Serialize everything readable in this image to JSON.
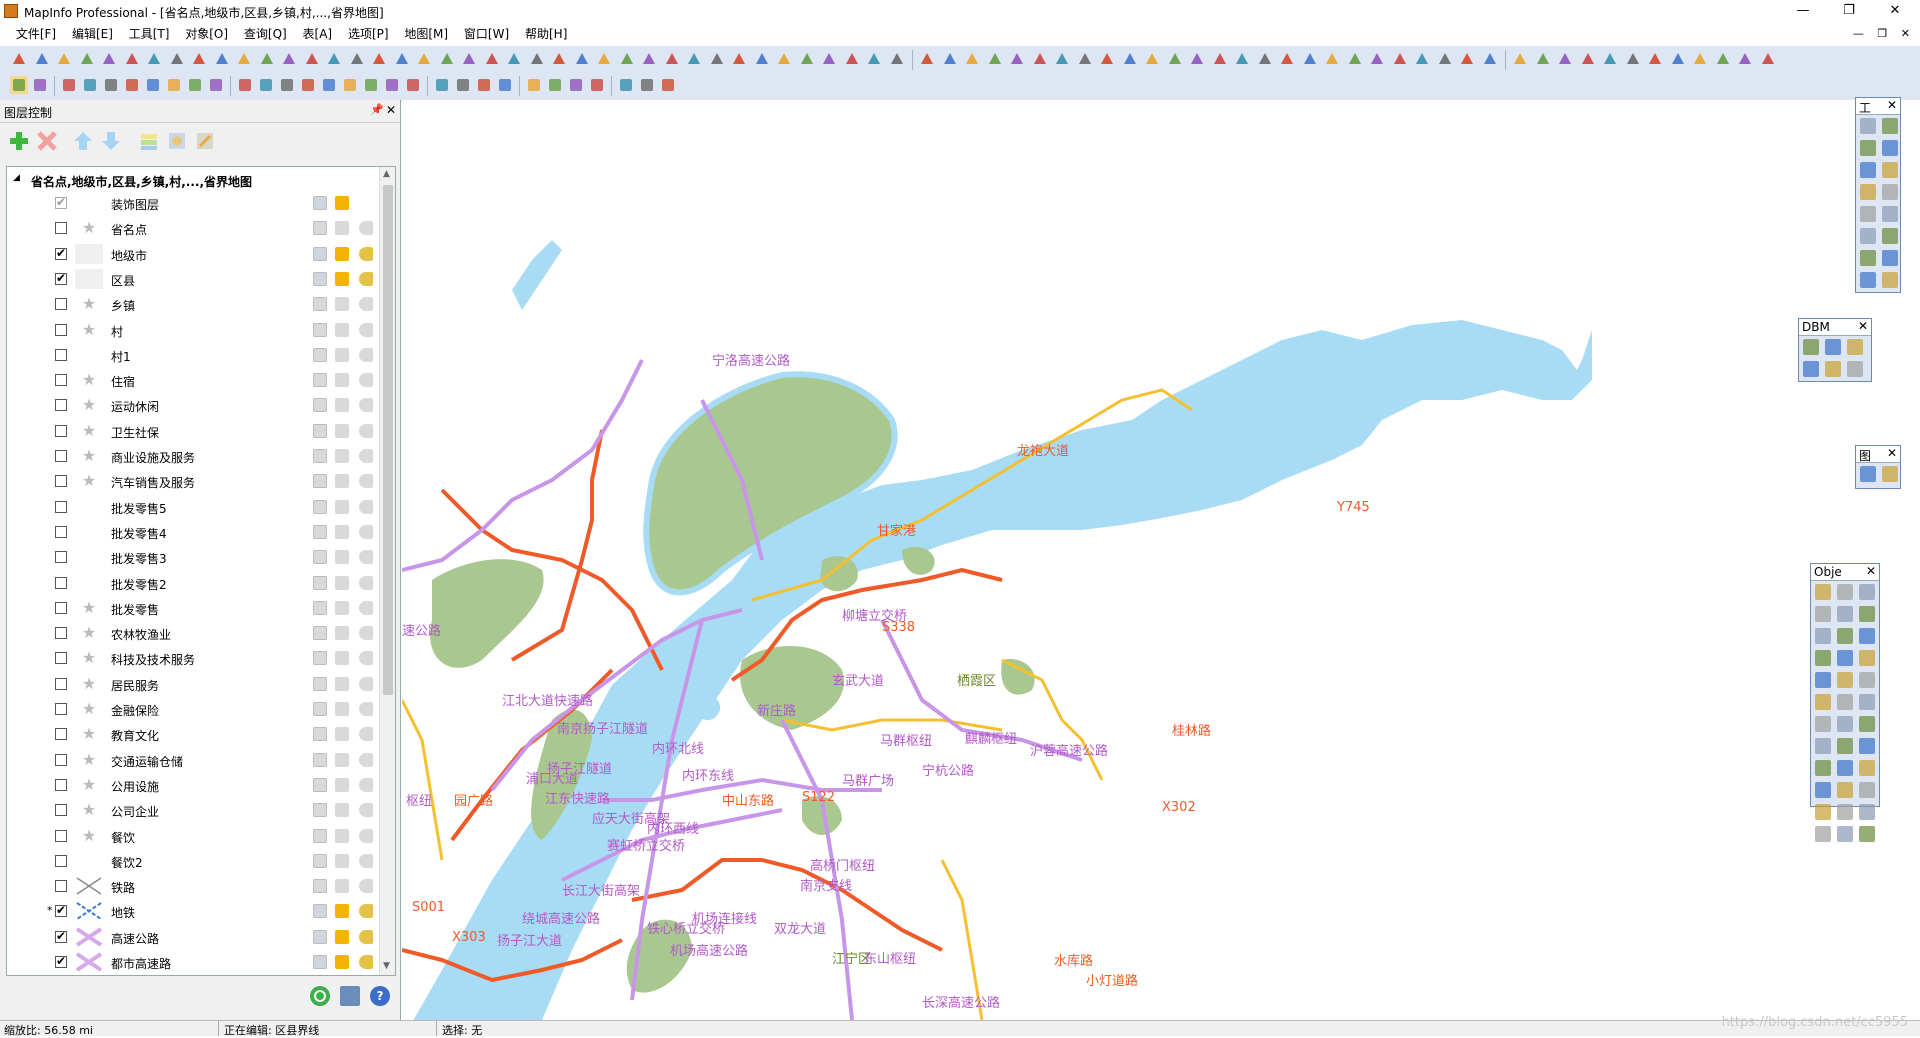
{
  "window": {
    "app_title": "MapInfo Professional - [省名点,地级市,区县,乡镇,村,...,省界地图]",
    "minimize": "—",
    "restore": "❐",
    "close": "✕"
  },
  "menu": {
    "items": [
      "文件[F]",
      "编辑[E]",
      "工具[T]",
      "对象[O]",
      "查询[Q]",
      "表[A]",
      "选项[P]",
      "地图[M]",
      "窗口[W]",
      "帮助[H]"
    ],
    "mdi_buttons": [
      "—",
      "❐",
      "✕"
    ]
  },
  "layer_control": {
    "title": "图层控制",
    "pin": "📌",
    "close": "✕",
    "root_expander": "◢",
    "root_name": "省名点,地级市,区县,乡镇,村,...,省界地图",
    "layers": [
      {
        "name": "装饰图层",
        "checked": true,
        "dim": true,
        "symbol": "",
        "sel": true,
        "lab": false,
        "labvis": false
      },
      {
        "name": "省名点",
        "checked": false,
        "dim": false,
        "symbol": "★",
        "sel": false,
        "lab": false,
        "labvis": true
      },
      {
        "name": "地级市",
        "checked": true,
        "dim": false,
        "symbol": "box",
        "sel": true,
        "lab": true,
        "labvis": true
      },
      {
        "name": "区县",
        "checked": true,
        "dim": false,
        "symbol": "box",
        "sel": true,
        "lab": true,
        "labvis": true
      },
      {
        "name": "乡镇",
        "checked": false,
        "dim": false,
        "symbol": "★",
        "sel": false,
        "lab": false,
        "labvis": true
      },
      {
        "name": "村",
        "checked": false,
        "dim": false,
        "symbol": "★",
        "sel": false,
        "lab": false,
        "labvis": true
      },
      {
        "name": "村1",
        "checked": false,
        "dim": false,
        "symbol": "",
        "sel": false,
        "lab": false,
        "labvis": true
      },
      {
        "name": "住宿",
        "checked": false,
        "dim": false,
        "symbol": "★",
        "sel": false,
        "lab": false,
        "labvis": true
      },
      {
        "name": "运动休闲",
        "checked": false,
        "dim": false,
        "symbol": "★",
        "sel": false,
        "lab": false,
        "labvis": true
      },
      {
        "name": "卫生社保",
        "checked": false,
        "dim": false,
        "symbol": "★",
        "sel": false,
        "lab": false,
        "labvis": true
      },
      {
        "name": "商业设施及服务",
        "checked": false,
        "dim": false,
        "symbol": "★",
        "sel": false,
        "lab": false,
        "labvis": true
      },
      {
        "name": "汽车销售及服务",
        "checked": false,
        "dim": false,
        "symbol": "★",
        "sel": false,
        "lab": false,
        "labvis": true
      },
      {
        "name": "批发零售5",
        "checked": false,
        "dim": false,
        "symbol": "",
        "sel": false,
        "lab": false,
        "labvis": true
      },
      {
        "name": "批发零售4",
        "checked": false,
        "dim": false,
        "symbol": "",
        "sel": false,
        "lab": false,
        "labvis": true
      },
      {
        "name": "批发零售3",
        "checked": false,
        "dim": false,
        "symbol": "",
        "sel": false,
        "lab": false,
        "labvis": true
      },
      {
        "name": "批发零售2",
        "checked": false,
        "dim": false,
        "symbol": "",
        "sel": false,
        "lab": false,
        "labvis": true
      },
      {
        "name": "批发零售",
        "checked": false,
        "dim": false,
        "symbol": "★",
        "sel": false,
        "lab": false,
        "labvis": true
      },
      {
        "name": "农林牧渔业",
        "checked": false,
        "dim": false,
        "symbol": "★",
        "sel": false,
        "lab": false,
        "labvis": true
      },
      {
        "name": "科技及技术服务",
        "checked": false,
        "dim": false,
        "symbol": "★",
        "sel": false,
        "lab": false,
        "labvis": true
      },
      {
        "name": "居民服务",
        "checked": false,
        "dim": false,
        "symbol": "★",
        "sel": false,
        "lab": false,
        "labvis": true
      },
      {
        "name": "金融保险",
        "checked": false,
        "dim": false,
        "symbol": "★",
        "sel": false,
        "lab": false,
        "labvis": true
      },
      {
        "name": "教育文化",
        "checked": false,
        "dim": false,
        "symbol": "★",
        "sel": false,
        "lab": false,
        "labvis": true
      },
      {
        "name": "交通运输仓储",
        "checked": false,
        "dim": false,
        "symbol": "★",
        "sel": false,
        "lab": false,
        "labvis": true
      },
      {
        "name": "公用设施",
        "checked": false,
        "dim": false,
        "symbol": "★",
        "sel": false,
        "lab": false,
        "labvis": true
      },
      {
        "name": "公司企业",
        "checked": false,
        "dim": false,
        "symbol": "★",
        "sel": false,
        "lab": false,
        "labvis": true
      },
      {
        "name": "餐饮",
        "checked": false,
        "dim": false,
        "symbol": "★",
        "sel": false,
        "lab": false,
        "labvis": true
      },
      {
        "name": "餐饮2",
        "checked": false,
        "dim": false,
        "symbol": "",
        "sel": false,
        "lab": false,
        "labvis": true
      },
      {
        "name": "铁路",
        "checked": false,
        "dim": false,
        "symbol": "✕",
        "sel": false,
        "lab": false,
        "labvis": true
      },
      {
        "name": "地铁",
        "checked": true,
        "dim": false,
        "symbol": "✕b",
        "sel": true,
        "lab": true,
        "labvis": true,
        "marker": "*"
      },
      {
        "name": "高速公路",
        "checked": true,
        "dim": false,
        "symbol": "✕p",
        "sel": true,
        "lab": true,
        "labvis": true
      },
      {
        "name": "都市高速路",
        "checked": true,
        "dim": false,
        "symbol": "✕p",
        "sel": true,
        "lab": true,
        "labvis": true
      }
    ]
  },
  "floating_toolbars": [
    {
      "title": "工",
      "close": "✕"
    },
    {
      "title": "DBM",
      "close": "✕"
    },
    {
      "title": "图",
      "close": "✕"
    },
    {
      "title": "Obje",
      "close": "✕"
    }
  ],
  "map": {
    "labels": [
      {
        "t": "宁洛高速公路",
        "c": "purple"
      },
      {
        "t": "柳塘立交桥",
        "c": "purple"
      },
      {
        "t": "S338",
        "c": "orange"
      },
      {
        "t": "栖霞区",
        "c": "green"
      },
      {
        "t": "玄武大道",
        "c": "purple"
      },
      {
        "t": "新庄路",
        "c": "purple"
      },
      {
        "t": "马群枢纽",
        "c": "purple"
      },
      {
        "t": "麒麟枢纽",
        "c": "purple"
      },
      {
        "t": "沪蓉高速公路",
        "c": "purple"
      },
      {
        "t": "宁杭公路",
        "c": "purple"
      },
      {
        "t": "马群广场",
        "c": "purple"
      },
      {
        "t": "江北大道快速路",
        "c": "purple"
      },
      {
        "t": "南京扬子江隧道",
        "c": "purple"
      },
      {
        "t": "内环北线",
        "c": "purple"
      },
      {
        "t": "扬子江隧道",
        "c": "purple"
      },
      {
        "t": "浦口大道",
        "c": "purple"
      },
      {
        "t": "江东快速路",
        "c": "purple"
      },
      {
        "t": "内环东线",
        "c": "purple"
      },
      {
        "t": "中山东路",
        "c": "orange"
      },
      {
        "t": "S122",
        "c": "orange"
      },
      {
        "t": "应天大街高架",
        "c": "purple"
      },
      {
        "t": "内环西线",
        "c": "purple"
      },
      {
        "t": "赛虹桥立交桥",
        "c": "purple"
      },
      {
        "t": "高桥门枢纽",
        "c": "purple"
      },
      {
        "t": "长江大街高架",
        "c": "purple"
      },
      {
        "t": "南京支线",
        "c": "purple"
      },
      {
        "t": "机场连接线",
        "c": "purple"
      },
      {
        "t": "绕城高速公路",
        "c": "purple"
      },
      {
        "t": "铁心桥立交桥",
        "c": "purple"
      },
      {
        "t": "双龙大道",
        "c": "purple"
      },
      {
        "t": "机场高速公路",
        "c": "purple"
      },
      {
        "t": "扬子江大道",
        "c": "purple"
      },
      {
        "t": "江宁区",
        "c": "green"
      },
      {
        "t": "东山枢纽",
        "c": "purple"
      },
      {
        "t": "X302",
        "c": "orange"
      },
      {
        "t": "X303",
        "c": "orange"
      },
      {
        "t": "S001",
        "c": "orange"
      },
      {
        "t": "桂林路",
        "c": "orange"
      },
      {
        "t": "水库路",
        "c": "orange"
      },
      {
        "t": "小灯道路",
        "c": "orange"
      },
      {
        "t": "长深高速公路",
        "c": "purple"
      },
      {
        "t": "枢纽",
        "c": "purple"
      },
      {
        "t": "园广路",
        "c": "orange"
      },
      {
        "t": "速公路",
        "c": "purple"
      },
      {
        "t": "Y745",
        "c": "orange"
      },
      {
        "t": "甘家港",
        "c": "orange"
      },
      {
        "t": "龙袍大道",
        "c": "orange"
      }
    ]
  },
  "status": {
    "zoom": "缩放比: 56.58 mi",
    "editing": "正在编辑: 区县界线",
    "selection": "选择: 无",
    "watermark": "https://blog.csdn.net/cc5955"
  }
}
